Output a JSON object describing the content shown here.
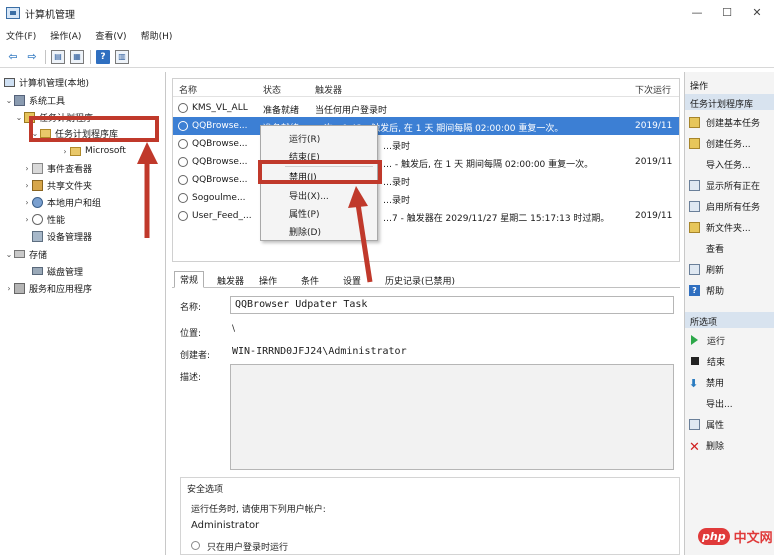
{
  "window": {
    "title": "计算机管理",
    "min": "—",
    "max": "☐",
    "close": "✕"
  },
  "menu": [
    "文件(F)",
    "操作(A)",
    "查看(V)",
    "帮助(H)"
  ],
  "tree": [
    {
      "label": "计算机管理(本地)",
      "icon": "computer-icon"
    },
    {
      "label": "系统工具",
      "icon": "tools-icon"
    },
    {
      "label": "任务计划程序",
      "icon": "task-scheduler-icon"
    },
    {
      "label": "任务计划程序库",
      "icon": "task-library-icon"
    },
    {
      "label": "Microsoft",
      "icon": "folder-icon"
    },
    {
      "label": "事件查看器",
      "icon": "event-viewer-icon"
    },
    {
      "label": "共享文件夹",
      "icon": "shared-folder-icon"
    },
    {
      "label": "本地用户和组",
      "icon": "users-icon"
    },
    {
      "label": "性能",
      "icon": "performance-icon"
    },
    {
      "label": "设备管理器",
      "icon": "device-manager-icon"
    },
    {
      "label": "存储",
      "icon": "storage-icon"
    },
    {
      "label": "磁盘管理",
      "icon": "disk-icon"
    },
    {
      "label": "服务和应用程序",
      "icon": "services-icon"
    }
  ],
  "list": {
    "headers": [
      "名称",
      "状态",
      "触发器",
      "下次运行"
    ],
    "rows": [
      {
        "name": "KMS_VL_ALL",
        "status": "准备就绪",
        "trigger": "当任何用户登录时",
        "next": ""
      },
      {
        "name": "QQBrowse...",
        "status": "准备就绪",
        "trigger": "…次…0:42 - 触发后, 在 1 天 期间每隔 02:00:00 重复一次。",
        "next": "2019/11"
      },
      {
        "name": "QQBrowse...",
        "status": "",
        "trigger": "…录时",
        "next": ""
      },
      {
        "name": "QQBrowse...",
        "status": "",
        "trigger": "… - 触发后, 在 1 天 期间每隔 02:00:00 重复一次。",
        "next": "2019/11"
      },
      {
        "name": "QQBrowse...",
        "status": "",
        "trigger": "…录时",
        "next": ""
      },
      {
        "name": "Sogoulme...",
        "status": "",
        "trigger": "…录时",
        "next": ""
      },
      {
        "name": "User_Feed_...",
        "status": "",
        "trigger": "…7 - 触发器在 2029/11/27 星期二 15:17:13 时过期。",
        "next": "2019/11"
      }
    ]
  },
  "context_menu": [
    "运行(R)",
    "结束(E)",
    "禁用(I)",
    "导出(X)...",
    "属性(P)",
    "删除(D)"
  ],
  "tabs": [
    "常规",
    "触发器",
    "操作",
    "条件",
    "设置",
    "历史记录(已禁用)"
  ],
  "detail": {
    "name_label": "名称:",
    "name_value": "QQBrowser Udpater Task",
    "location_label": "位置:",
    "location_value": "\\",
    "author_label": "创建者:",
    "author_value": "WIN-IRRND0JFJ24\\Administrator",
    "desc_label": "描述:",
    "security_title": "安全选项",
    "security_prompt": "运行任务时, 请使用下列用户帐户:",
    "security_user": "Administrator",
    "security_radio": "只在用户登录时运行"
  },
  "actions": {
    "head1": "操作",
    "head2": "任务计划程序库",
    "items1": [
      {
        "label": "创建基本任务",
        "icon": "create-basic-task-icon"
      },
      {
        "label": "创建任务...",
        "icon": "create-task-icon"
      },
      {
        "label": "导入任务...",
        "icon": "import-task-icon"
      },
      {
        "label": "显示所有正在",
        "icon": "show-running-icon"
      },
      {
        "label": "启用所有任务",
        "icon": "enable-history-icon"
      },
      {
        "label": "新文件夹...",
        "icon": "new-folder-icon"
      },
      {
        "label": "查看",
        "icon": "view-icon"
      },
      {
        "label": "刷新",
        "icon": "refresh-icon"
      },
      {
        "label": "帮助",
        "icon": "help-icon"
      }
    ],
    "head3": "所选项",
    "items2": [
      {
        "label": "运行",
        "icon": "run-icon"
      },
      {
        "label": "结束",
        "icon": "end-icon"
      },
      {
        "label": "禁用",
        "icon": "disable-icon"
      },
      {
        "label": "导出...",
        "icon": "export-icon"
      },
      {
        "label": "属性",
        "icon": "properties-icon"
      },
      {
        "label": "删除",
        "icon": "delete-icon"
      }
    ]
  },
  "watermark": {
    "logo": "php",
    "text": "中文网"
  }
}
